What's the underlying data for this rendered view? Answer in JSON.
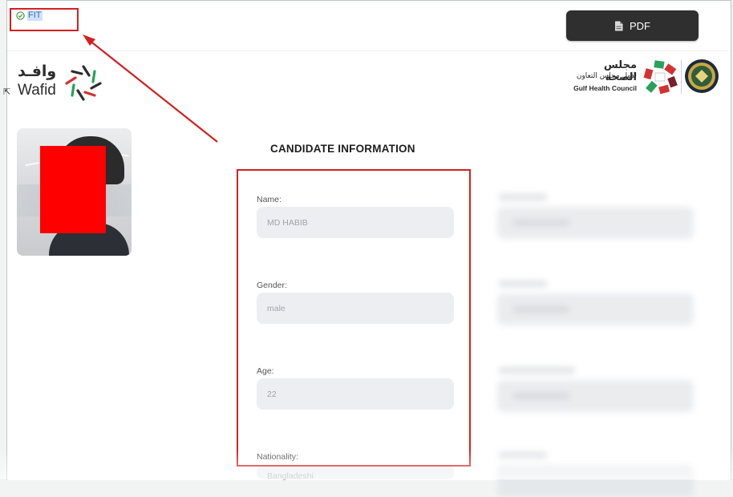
{
  "status": {
    "icon": "check-circle-icon",
    "label": "FIT",
    "color": "#3a9c3a"
  },
  "toolbar": {
    "pdf_icon": "pdf-file-icon",
    "pdf_label": "PDF"
  },
  "logos": {
    "wafid_arabic": "وافـد",
    "wafid_english": "Wafid",
    "ghc_arabic_1": "مجلس الصحة",
    "ghc_arabic_2": "لدول مجلس التعاون",
    "ghc_english": "Gulf Health Council"
  },
  "candidate": {
    "title": "CANDIDATE INFORMATION",
    "fields": [
      {
        "label": "Name:",
        "value": "MD HABIB"
      },
      {
        "label": "Gender:",
        "value": "male"
      },
      {
        "label": "Age:",
        "value": "22"
      },
      {
        "label": "Nationality:",
        "value": "Bangladeshi"
      }
    ]
  },
  "colors": {
    "annotation_red": "#d42020",
    "button_dark": "#2f2f2f",
    "field_bg": "#eceef2"
  }
}
